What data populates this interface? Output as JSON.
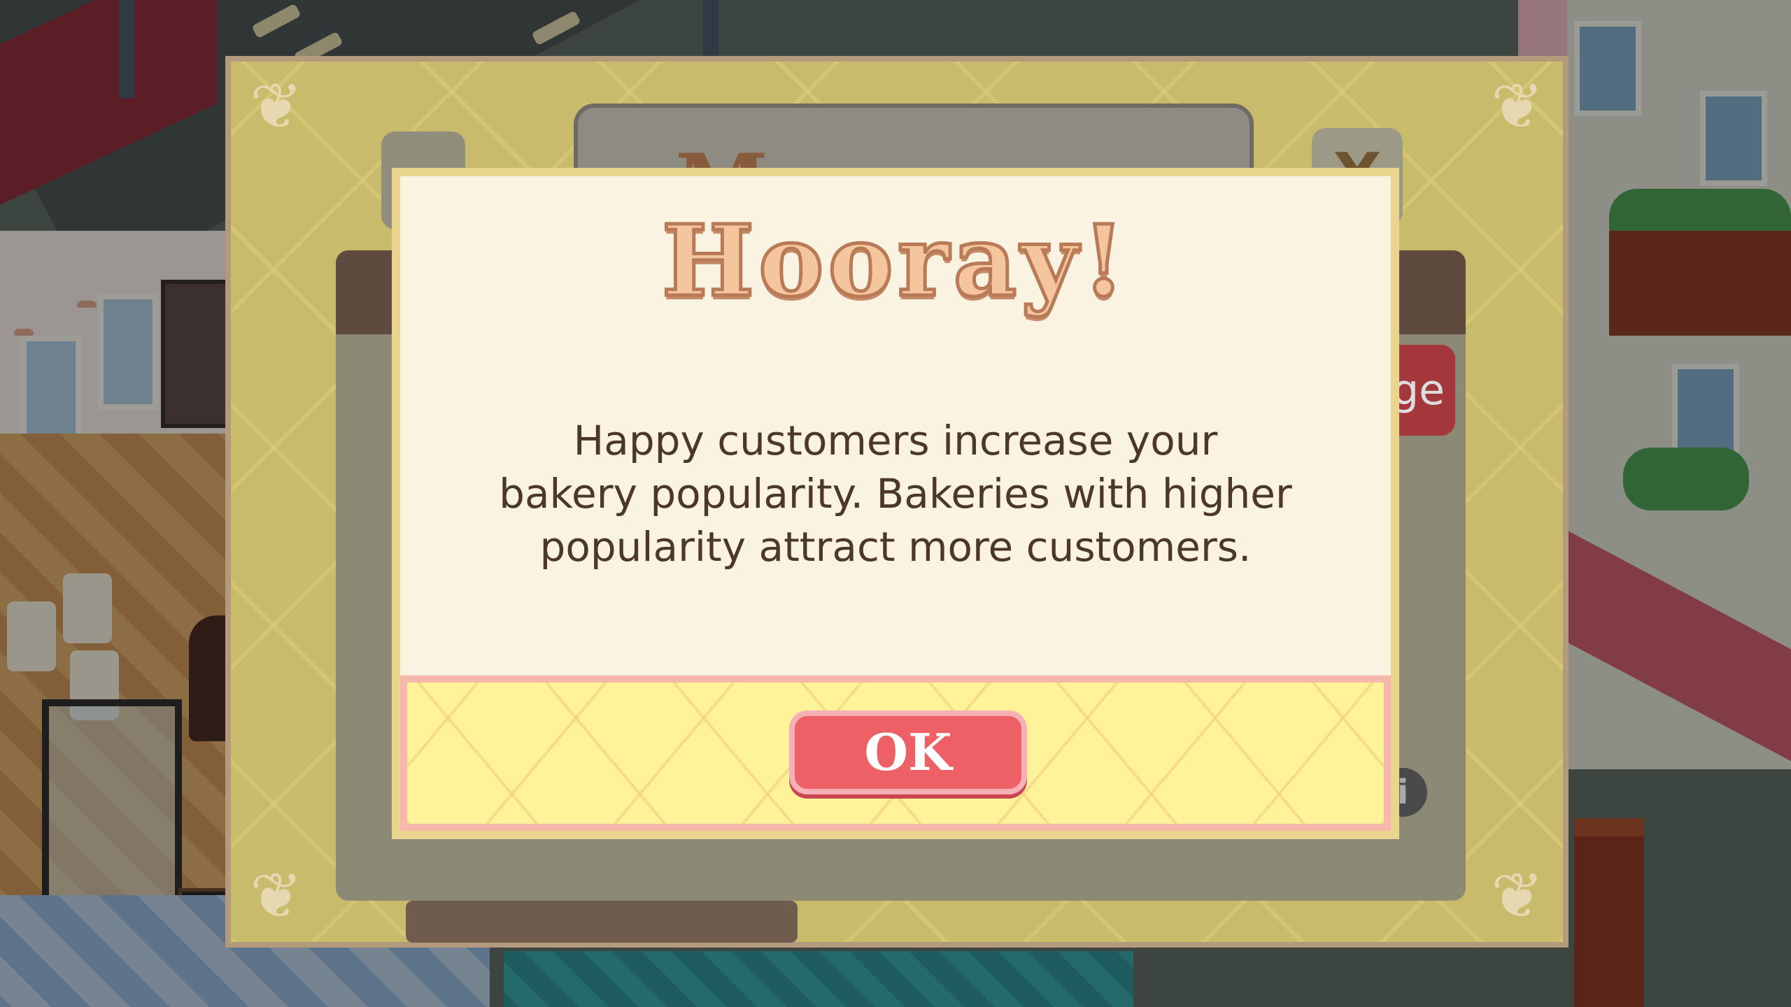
{
  "messages_panel": {
    "title": "Messages",
    "close_label": "X",
    "info_label": "i",
    "side_button_fragment": "ge"
  },
  "dialog": {
    "title": "Hooray!",
    "body_lines": [
      "Happy customers increase your",
      "bakery popularity. Bakeries with higher",
      "popularity attract more customers."
    ],
    "ok_label": "OK"
  },
  "colors": {
    "dialog_background": "#faf3e2",
    "footer_background": "#fff39a",
    "ok_button": "#ec6066",
    "title_text": "#f5c59d"
  }
}
